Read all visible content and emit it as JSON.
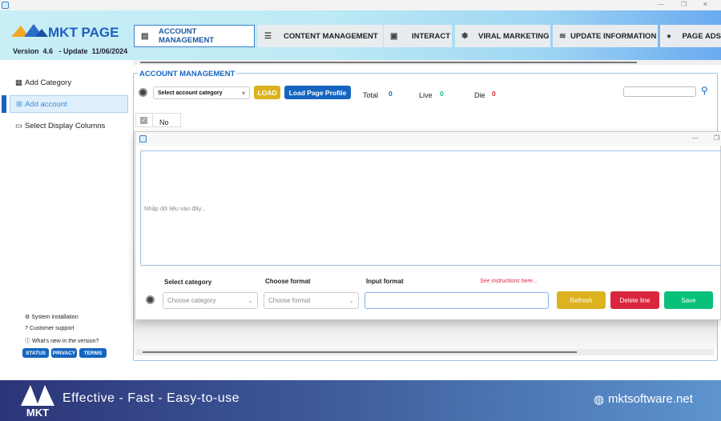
{
  "app": {
    "name": "MKT PAGE",
    "version_label": "Version",
    "version": "4.6",
    "update_label": "- Update",
    "update_date": "11/06/2024"
  },
  "window_controls": {
    "minimize": "—",
    "restore": "❐",
    "close": "✕"
  },
  "tabs": [
    {
      "label": "ACCOUNT MANAGEMENT",
      "icon": "▤",
      "active": true
    },
    {
      "label": "CONTENT MANAGEMENT",
      "icon": "☰"
    },
    {
      "label": "INTERACT",
      "icon": "▣"
    },
    {
      "label": "VIRAL MARKETING",
      "icon": "❃"
    },
    {
      "label": "UPDATE INFORMATION",
      "icon": "≋"
    },
    {
      "label": "PAGE ADS",
      "icon": "●"
    }
  ],
  "sidebar": {
    "items": [
      {
        "label": "Add Category",
        "icon": "▦"
      },
      {
        "label": "Add account",
        "icon": "⊞",
        "active": true
      },
      {
        "label": "Select Display Columns",
        "icon": "▭"
      }
    ],
    "links": [
      {
        "label": "System installation",
        "icon": "⚙"
      },
      {
        "label": "Customer support",
        "icon": "?"
      },
      {
        "label": "What's new in the version?",
        "icon": "ⓘ"
      }
    ],
    "buttons": [
      "STATUS",
      "PRIVACY",
      "TERMS"
    ]
  },
  "main": {
    "section_title": "ACCOUNT MANAGEMENT",
    "category_select": "Select account category",
    "load": "LOAD",
    "load_profile": "Load Page Profile",
    "total_label": "Total",
    "total": "0",
    "live_label": "Live",
    "live": "0",
    "die_label": "Die",
    "die": "0",
    "search_value": "",
    "table_header": "No"
  },
  "dialog": {
    "textarea_placeholder": "Nhập dữ liệu vào đây...",
    "select_category_label": "Select category",
    "select_category_placeholder": "Choose category",
    "choose_format_label": "Choose format",
    "choose_format_placeholder": "Choose format",
    "input_format_label": "Input format",
    "input_format_value": "",
    "instructions": "See instructions here...",
    "refresh": "Refresh",
    "delete_line": "Delete line",
    "save": "Save"
  },
  "footer": {
    "slogan": "Effective - Fast - Easy-to-use",
    "website": "mktsoftware.net",
    "logo_text": "MKT"
  },
  "colors": {
    "accent": "#1565c0",
    "load": "#dcb21e",
    "delete": "#d9263c",
    "save": "#08c07a",
    "live": "#14b886",
    "die": "#d9263c"
  }
}
